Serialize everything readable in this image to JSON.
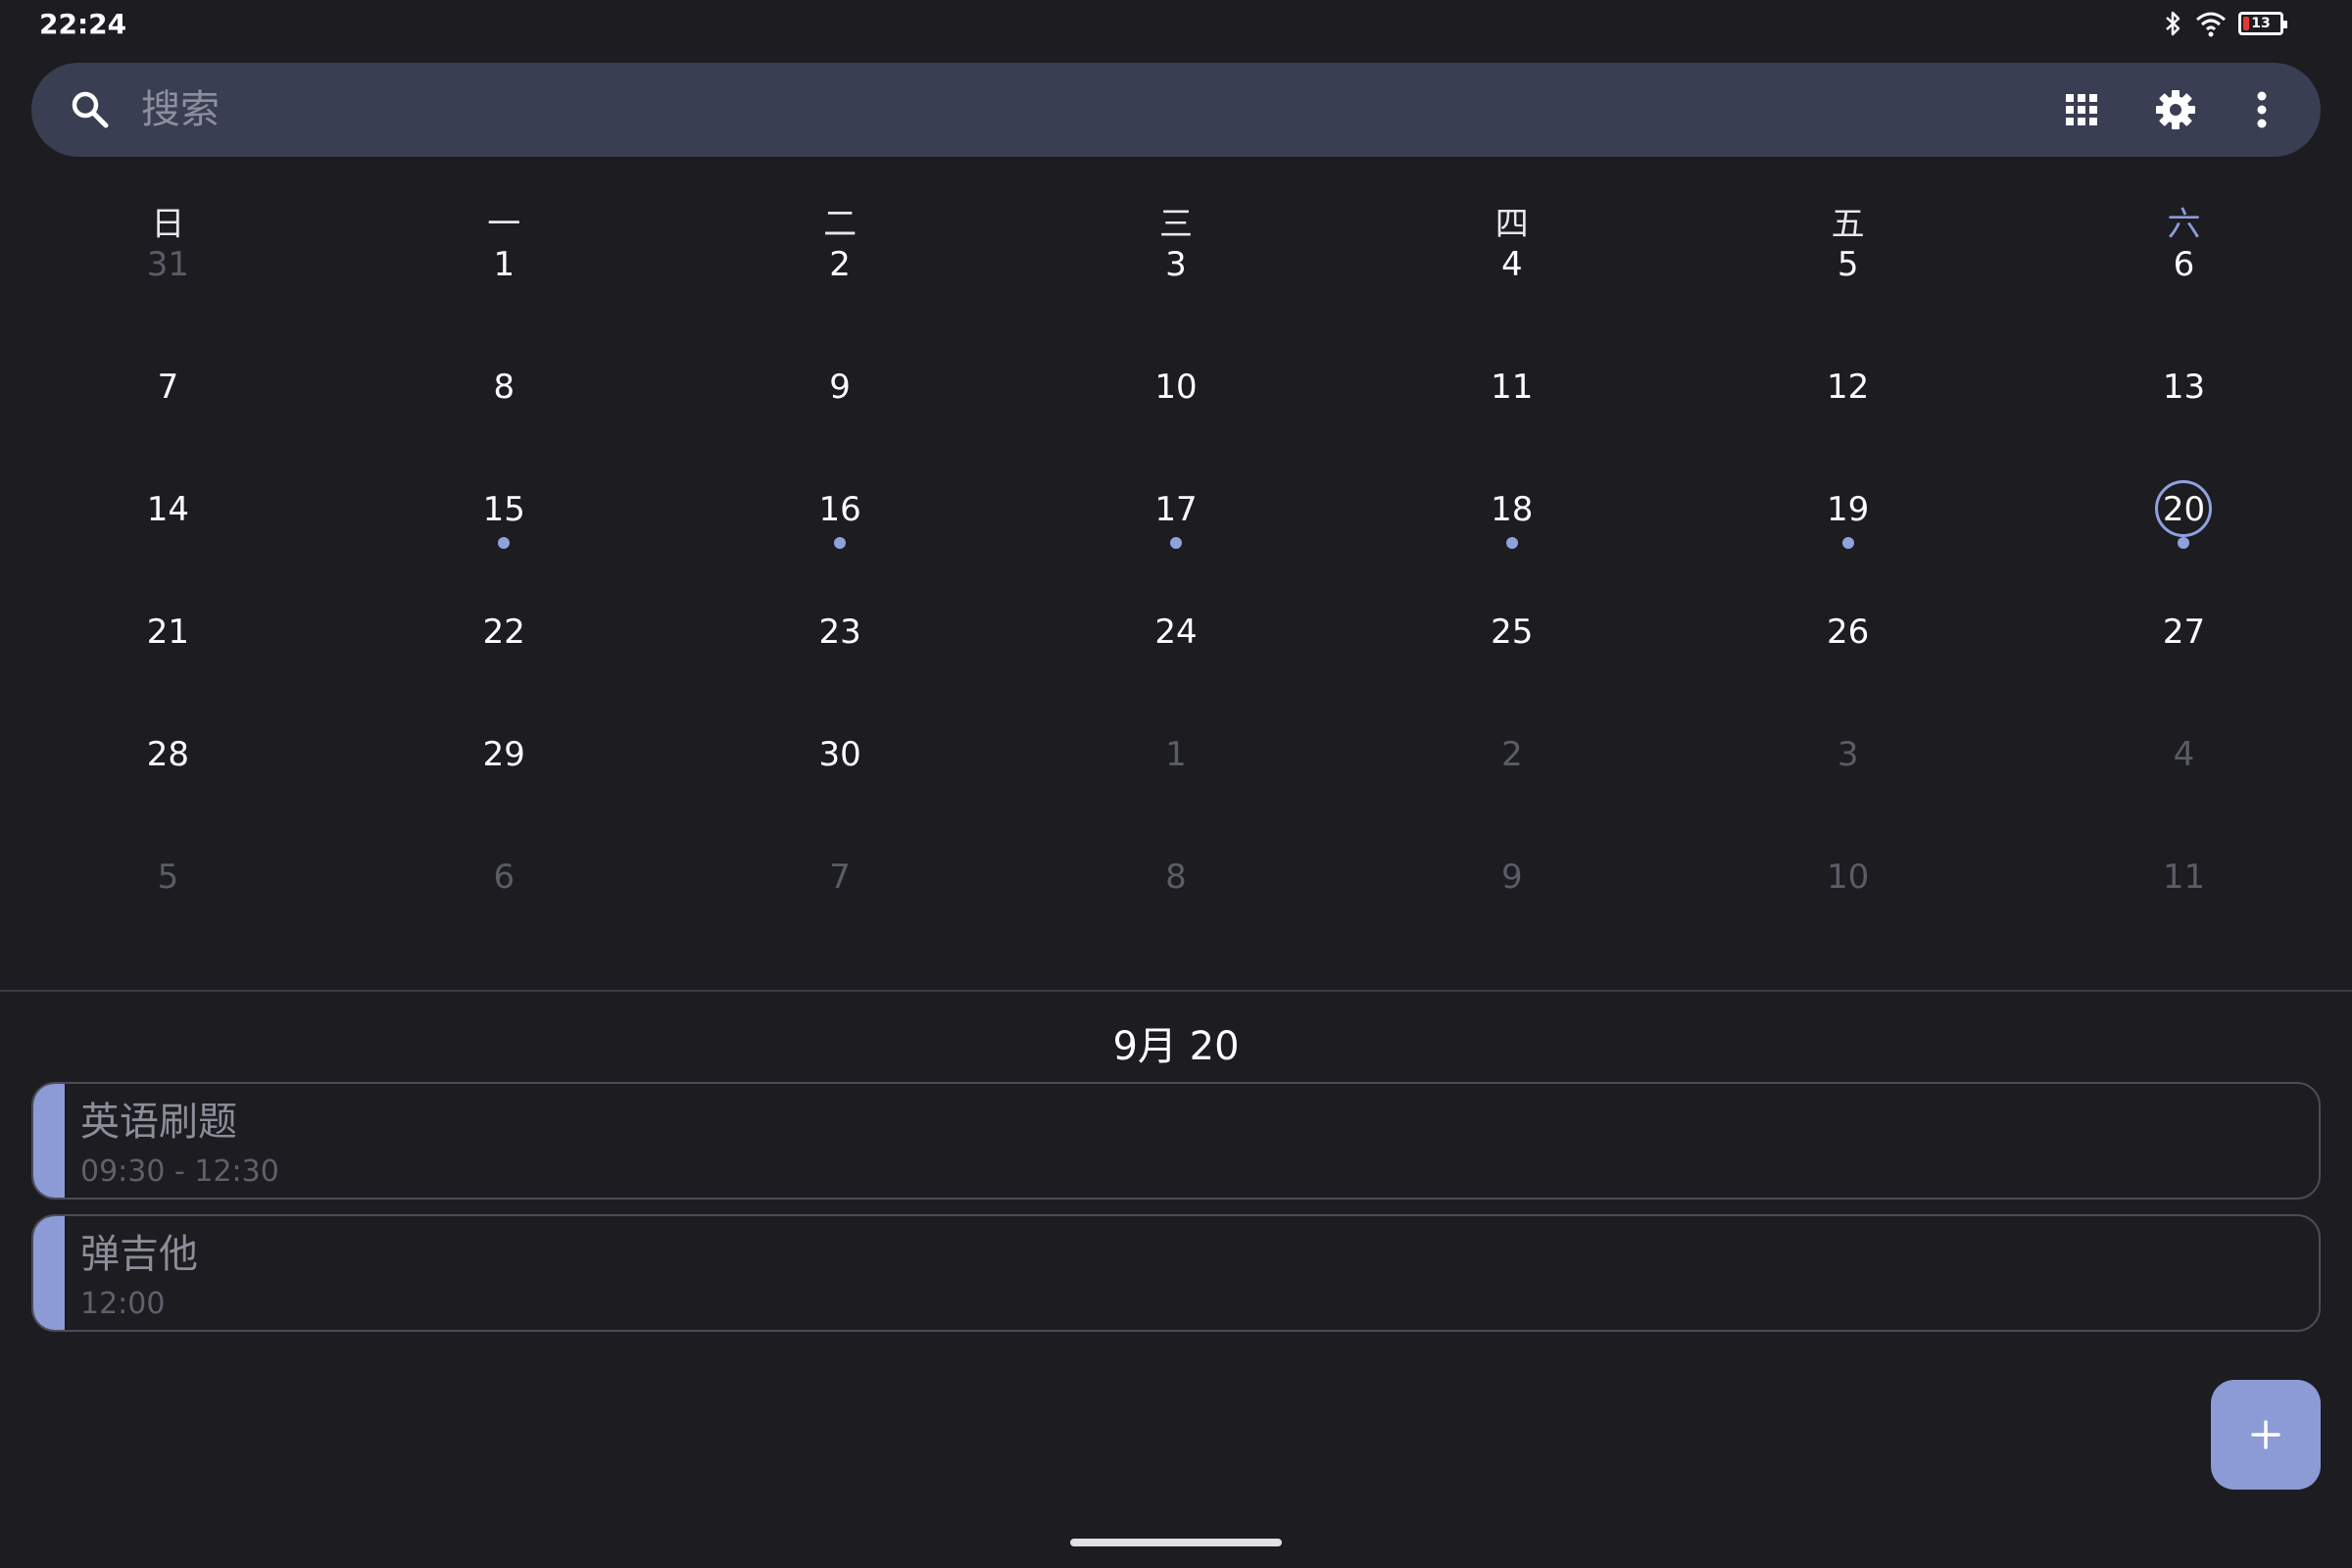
{
  "status_bar": {
    "time": "22:24",
    "battery_level": "13",
    "icons": [
      "bluetooth-icon",
      "wifi-icon",
      "battery-icon"
    ]
  },
  "search": {
    "placeholder": "搜索",
    "value": ""
  },
  "toolbar": {
    "icons": [
      "grid-view-icon",
      "gear-icon",
      "more-vert-icon"
    ]
  },
  "calendar": {
    "weekdays": [
      "日",
      "一",
      "二",
      "三",
      "四",
      "五",
      "六"
    ],
    "weeks": [
      [
        {
          "d": "31",
          "o": true
        },
        {
          "d": "1"
        },
        {
          "d": "2"
        },
        {
          "d": "3"
        },
        {
          "d": "4"
        },
        {
          "d": "5"
        },
        {
          "d": "6"
        }
      ],
      [
        {
          "d": "7"
        },
        {
          "d": "8"
        },
        {
          "d": "9"
        },
        {
          "d": "10"
        },
        {
          "d": "11"
        },
        {
          "d": "12"
        },
        {
          "d": "13"
        }
      ],
      [
        {
          "d": "14"
        },
        {
          "d": "15",
          "dot": true
        },
        {
          "d": "16",
          "dot": true
        },
        {
          "d": "17",
          "dot": true
        },
        {
          "d": "18",
          "dot": true
        },
        {
          "d": "19",
          "dot": true
        },
        {
          "d": "20",
          "dot": true,
          "today": true
        }
      ],
      [
        {
          "d": "21"
        },
        {
          "d": "22"
        },
        {
          "d": "23"
        },
        {
          "d": "24"
        },
        {
          "d": "25"
        },
        {
          "d": "26"
        },
        {
          "d": "27"
        }
      ],
      [
        {
          "d": "28"
        },
        {
          "d": "29"
        },
        {
          "d": "30"
        },
        {
          "d": "1",
          "o": true
        },
        {
          "d": "2",
          "o": true
        },
        {
          "d": "3",
          "o": true
        },
        {
          "d": "4",
          "o": true
        }
      ],
      [
        {
          "d": "5",
          "o": true
        },
        {
          "d": "6",
          "o": true
        },
        {
          "d": "7",
          "o": true
        },
        {
          "d": "8",
          "o": true
        },
        {
          "d": "9",
          "o": true
        },
        {
          "d": "10",
          "o": true
        },
        {
          "d": "11",
          "o": true
        }
      ]
    ]
  },
  "selected_date": "9月 20",
  "events": [
    {
      "title": "英语刷题",
      "time": "09:30 - 12:30",
      "color": "#8c9bd6"
    },
    {
      "title": "弹吉他",
      "time": "12:00",
      "color": "#8c9bd6"
    }
  ],
  "colors": {
    "background": "#1c1c21",
    "accent": "#8c9bd6",
    "search_bar": "#3a3e52"
  }
}
